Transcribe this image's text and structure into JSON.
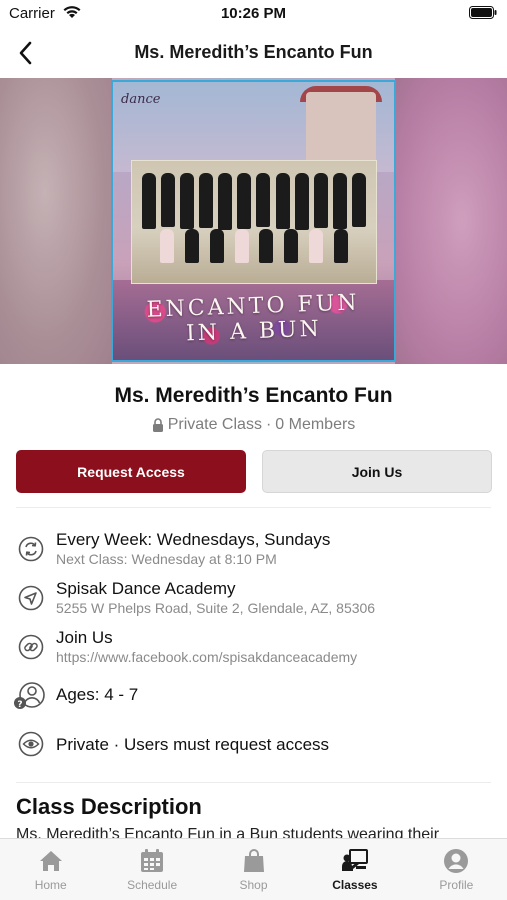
{
  "status_bar": {
    "carrier": "Carrier",
    "time": "10:26 PM"
  },
  "nav": {
    "title": "Ms. Meredith’s Encanto Fun",
    "back_icon": "chevron-left-icon"
  },
  "hero": {
    "logo_text": "dance",
    "banner_text": "ENCANTO FUN IN A BUN",
    "frame_color": "#3aa8d8"
  },
  "class": {
    "title": "Ms. Meredith’s Encanto Fun",
    "visibility": "Private Class",
    "separator": "·",
    "members": "0 Members"
  },
  "actions": {
    "request_label": "Request Access",
    "join_label": "Join Us",
    "accent_color": "#8b0f1c"
  },
  "details": {
    "schedule": {
      "icon": "repeat-icon",
      "primary": "Every Week: Wednesdays, Sundays",
      "secondary": "Next Class: Wednesday at 8:10 PM"
    },
    "location": {
      "icon": "location-arrow-icon",
      "primary": "Spisak Dance Academy",
      "secondary": "5255 W Phelps Road, Suite 2, Glendale, AZ, 85306"
    },
    "link": {
      "icon": "link-icon",
      "primary": "Join Us",
      "secondary": "https://www.facebook.com/spisakdanceacademy"
    },
    "ages": {
      "icon": "users-question-icon",
      "primary": "Ages: 4 - 7"
    },
    "privacy": {
      "icon": "eye-icon",
      "primary": "Private · Users must request access"
    }
  },
  "description": {
    "title": "Class Description",
    "text": "Ms. Meredith’s Encanto Fun in a Bun students wearing their"
  },
  "tabs": [
    {
      "label": "Home",
      "icon": "home-icon"
    },
    {
      "label": "Schedule",
      "icon": "calendar-icon"
    },
    {
      "label": "Shop",
      "icon": "shopping-bag-icon"
    },
    {
      "label": "Classes",
      "icon": "classes-icon",
      "active": true
    },
    {
      "label": "Profile",
      "icon": "profile-icon"
    }
  ]
}
